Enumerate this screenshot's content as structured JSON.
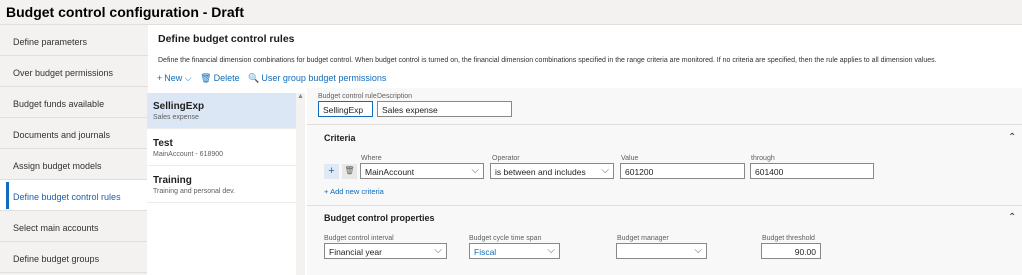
{
  "title": "Budget control configuration - Draft",
  "sidebar": {
    "items": [
      {
        "label": "Define parameters"
      },
      {
        "label": "Over budget permissions"
      },
      {
        "label": "Budget funds available"
      },
      {
        "label": "Documents and journals"
      },
      {
        "label": "Assign budget models"
      },
      {
        "label": "Define budget control rules"
      },
      {
        "label": "Select main accounts"
      },
      {
        "label": "Define budget groups"
      }
    ]
  },
  "main": {
    "heading": "Define budget control rules",
    "description": "Define the financial dimension combinations for budget control. When budget control is turned on, the financial dimension combinations specified in the range criteria are monitored. If no criteria are specified, then the rule applies to all dimension values.",
    "toolbar": {
      "new_label": "New",
      "delete_label": "Delete",
      "permissions_label": "User group budget permissions"
    }
  },
  "rules_list": [
    {
      "name": "SellingExp",
      "sub": "Sales expense"
    },
    {
      "name": "Test",
      "sub": "MainAccount - 618900"
    },
    {
      "name": "Training",
      "sub": "Training and personal dev."
    }
  ],
  "detail": {
    "rule_label": "Budget control rule",
    "rule_value": "SellingExp",
    "description_label": "Description",
    "description_value": "Sales expense",
    "criteria": {
      "title": "Criteria",
      "where_label": "Where",
      "operator_label": "Operator",
      "value_label": "Value",
      "through_label": "through",
      "where_value": "MainAccount",
      "operator_value": "is between and includes",
      "value_value": "601200",
      "through_value": "601400",
      "add_label": "Add new criteria"
    },
    "properties": {
      "title": "Budget control properties",
      "interval_label": "Budget control interval",
      "interval_value": "Financial year",
      "timespan_label": "Budget cycle time span",
      "timespan_value": "Fiscal",
      "manager_label": "Budget manager",
      "manager_value": "",
      "threshold_label": "Budget threshold",
      "threshold_value": "90.00"
    }
  },
  "colors": {
    "accent": "#0f6cbd",
    "selected_row": "#dbe7f5",
    "sidebar_bg": "#f3f2f1"
  },
  "icons": [
    "plus-icon",
    "chevron-down-icon",
    "trash-icon",
    "search-people-icon",
    "chevron-up-icon"
  ]
}
